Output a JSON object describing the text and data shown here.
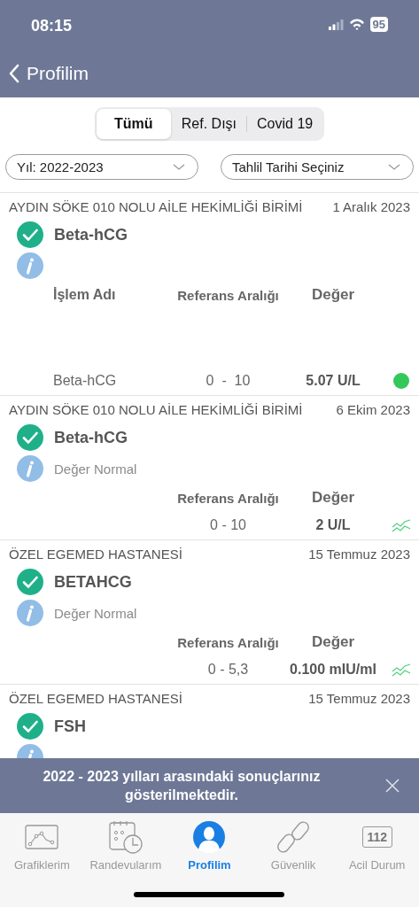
{
  "status_bar": {
    "time": "08:15",
    "battery": "95"
  },
  "nav": {
    "title": "Profilim"
  },
  "segments": [
    {
      "label": "Tümü",
      "selected": true
    },
    {
      "label": "Ref. Dışı",
      "selected": false
    },
    {
      "label": "Covid 19",
      "selected": false
    }
  ],
  "filters": [
    {
      "value": "Yıl: 2022-2023"
    },
    {
      "value": "Tahlil Tarihi Seçiniz"
    }
  ],
  "results": [
    {
      "institution": "AYDIN SÖKE 010 NOLU AİLE HEKİMLİĞİ BİRİMİ",
      "date": "1 Aralık 2023",
      "test": "Beta-hCG",
      "columns": {
        "name": "İşlem Adı",
        "range": "Referans Aralığı",
        "value": "Değer"
      },
      "rows": [
        {
          "name": "Beta-hCG",
          "range": "0  -  10",
          "value": "5.07 U/L",
          "kind": "dot"
        }
      ]
    },
    {
      "institution": "AYDIN SÖKE 010 NOLU AİLE HEKİMLİĞİ BİRİMİ",
      "date": "6 Ekim 2023",
      "test": "Beta-hCG",
      "note": "Değer Normal",
      "columns": {
        "range": "Referans Aralığı",
        "value": "Değer"
      },
      "rows": [
        {
          "range": "0 - 10",
          "value": "2 U/L",
          "kind": "trend"
        }
      ]
    },
    {
      "institution": "ÖZEL EGEMED HASTANESİ",
      "date": "15 Temmuz 2023",
      "test": "BETAHCG",
      "note": "Değer Normal",
      "columns": {
        "range": "Referans Aralığı",
        "value": "Değer"
      },
      "rows": [
        {
          "range": "0 - 5,3",
          "value": "0.100 mIU/ml",
          "kind": "trend"
        }
      ]
    },
    {
      "institution": "ÖZEL EGEMED HASTANESİ",
      "date": "15 Temmuz 2023",
      "test": "FSH"
    }
  ],
  "toast": {
    "message": "2022 - 2023 yılları arasındaki sonuçlarınız gösterilmektedir."
  },
  "tabbar": [
    {
      "label": "Grafiklerim",
      "selected": false,
      "kind": "chart"
    },
    {
      "label": "Randevularım",
      "selected": false,
      "kind": "calendar"
    },
    {
      "label": "Profilim",
      "selected": true,
      "kind": "person"
    },
    {
      "label": "Güvenlik",
      "selected": false,
      "kind": "link"
    },
    {
      "label": "Acil Durum",
      "selected": false,
      "kind": "emergency",
      "icon_text": "112"
    }
  ]
}
